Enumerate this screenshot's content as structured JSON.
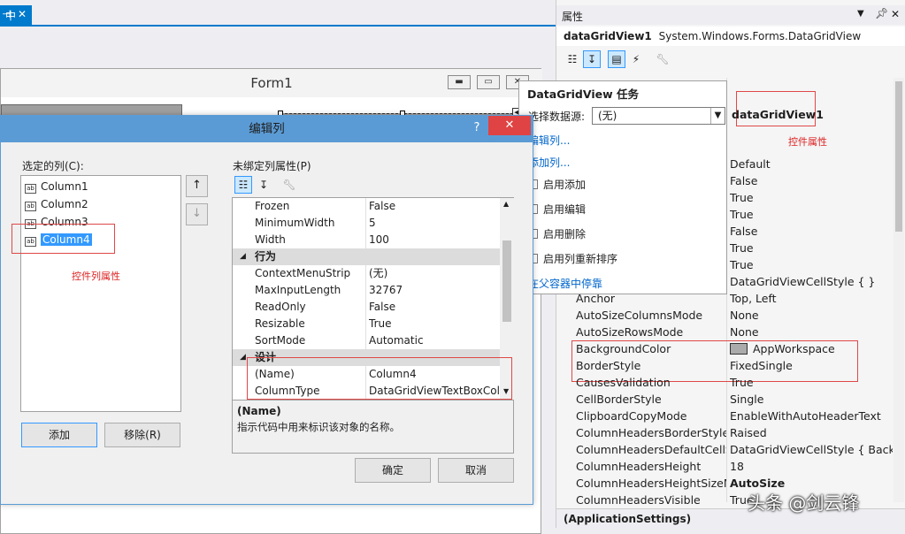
{
  "designer": {
    "tab_label": "中",
    "form_title": "Form1"
  },
  "properties": {
    "panel_title": "属性",
    "object_name": "dataGridView1",
    "object_type": "System.Windows.Forms.DataGridView",
    "annotation_box_name": "dataGridView1",
    "annotation_label": "控件属性",
    "footer": "(ApplicationSettings)",
    "rows": [
      {
        "name": "",
        "value": "Default"
      },
      {
        "name": "",
        "value": "False"
      },
      {
        "name": "",
        "value": "True"
      },
      {
        "name": "",
        "value": "True"
      },
      {
        "name": "",
        "value": "False"
      },
      {
        "name": "",
        "value": "True"
      },
      {
        "name": "",
        "value": "True"
      },
      {
        "name": "",
        "value": "DataGridViewCellStyle { }"
      },
      {
        "name": "Anchor",
        "value": "Top, Left"
      },
      {
        "name": "AutoSizeColumnsMode",
        "value": "None"
      },
      {
        "name": "AutoSizeRowsMode",
        "value": "None"
      },
      {
        "name": "BackgroundColor",
        "value": "AppWorkspace",
        "swatch": "#ababab"
      },
      {
        "name": "BorderStyle",
        "value": "FixedSingle"
      },
      {
        "name": "CausesValidation",
        "value": "True"
      },
      {
        "name": "CellBorderStyle",
        "value": "Single"
      },
      {
        "name": "ClipboardCopyMode",
        "value": "EnableWithAutoHeaderText"
      },
      {
        "name": "ColumnHeadersBorderStyle",
        "value": "Raised"
      },
      {
        "name": "ColumnHeadersDefaultCellSty",
        "value": "DataGridViewCellStyle { BackCc"
      },
      {
        "name": "ColumnHeadersHeight",
        "value": "18"
      },
      {
        "name": "ColumnHeadersHeightSizeMo",
        "value": "AutoSize",
        "bold": true
      },
      {
        "name": "ColumnHeadersVisible",
        "value": "True"
      }
    ]
  },
  "tasks": {
    "title": "DataGridView 任务",
    "datasource_label": "选择数据源:",
    "datasource_value": "(无)",
    "edit_columns": "编辑列...",
    "add_column": "添加列...",
    "checks": [
      "启用添加",
      "启用编辑",
      "启用删除",
      "启用列重新排序"
    ],
    "dock_link": "在父容器中停靠"
  },
  "dialog": {
    "title": "编辑列",
    "help": "?",
    "close": "✕",
    "selected_columns_label": "选定的列(C):",
    "columns": [
      "Column1",
      "Column2",
      "Column3",
      "Column4"
    ],
    "selected_index": 3,
    "annotation_label": "控件列属性",
    "move_up": "↑",
    "move_down": "↓",
    "add_button": "添加",
    "remove_button": "移除(R)",
    "unbound_label": "未绑定列属性(P)",
    "grid_rows": [
      {
        "type": "prop",
        "name": "Frozen",
        "value": "False"
      },
      {
        "type": "prop",
        "name": "MinimumWidth",
        "value": "5"
      },
      {
        "type": "prop",
        "name": "Width",
        "value": "100"
      },
      {
        "type": "cat",
        "name": "行为"
      },
      {
        "type": "prop",
        "name": "ContextMenuStrip",
        "value": "(无)"
      },
      {
        "type": "prop",
        "name": "MaxInputLength",
        "value": "32767"
      },
      {
        "type": "prop",
        "name": "ReadOnly",
        "value": "False"
      },
      {
        "type": "prop",
        "name": "Resizable",
        "value": "True"
      },
      {
        "type": "prop",
        "name": "SortMode",
        "value": "Automatic"
      },
      {
        "type": "cat",
        "name": "设计"
      },
      {
        "type": "prop",
        "name": "(Name)",
        "value": "Column4"
      },
      {
        "type": "prop",
        "name": "ColumnType",
        "value": "DataGridViewTextBoxColu"
      }
    ],
    "desc_name": "(Name)",
    "desc_text": "指示代码中用来标识该对象的名称。",
    "ok_button": "确定",
    "cancel_button": "取消"
  },
  "watermark": "头条 @剑云锋",
  "colors": {
    "accent": "#007acc",
    "dialog_title": "#5b9bd5",
    "close_red": "#e04343",
    "annotation_red": "#e04848",
    "selection": "#3399ff"
  }
}
